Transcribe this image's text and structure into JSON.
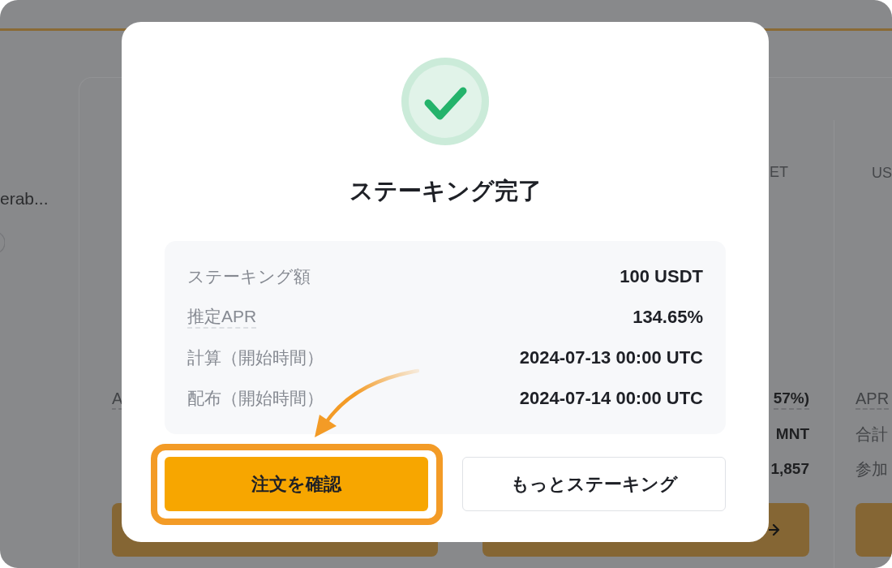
{
  "background": {
    "side_text": "erab...",
    "columns": [
      {
        "stats": [
          {
            "kind": "label",
            "text": "A",
            "dotted": true
          }
        ]
      },
      {
        "heading": "ET",
        "stats": [
          {
            "kind": "value",
            "text": "57%)",
            "dotted": true
          },
          {
            "kind": "value",
            "text": "MNT",
            "dotted": false
          },
          {
            "kind": "value",
            "text": "1,857",
            "dotted": false
          }
        ],
        "button_arrow": true
      },
      {
        "heading": "US",
        "stats": [
          {
            "kind": "label",
            "text": "APR",
            "dotted": true
          },
          {
            "kind": "label",
            "text": "合計",
            "dotted": false
          },
          {
            "kind": "label",
            "text": "参加",
            "dotted": false
          }
        ],
        "button_arrow": false
      }
    ]
  },
  "modal": {
    "title": "ステーキング完了",
    "details": [
      {
        "label": "ステーキング額",
        "value": "100 USDT",
        "dotted": false
      },
      {
        "label": "推定APR",
        "value": "134.65%",
        "dotted": true
      },
      {
        "label": "計算（開始時間）",
        "value": "2024-07-13 00:00 UTC",
        "dotted": false
      },
      {
        "label": "配布（開始時間）",
        "value": "2024-07-14 00:00 UTC",
        "dotted": false
      }
    ],
    "buttons": [
      {
        "kind": "primary",
        "label": "注文を確認",
        "highlighted": true
      },
      {
        "kind": "secondary",
        "label": "もっとステーキング",
        "highlighted": false
      }
    ]
  }
}
